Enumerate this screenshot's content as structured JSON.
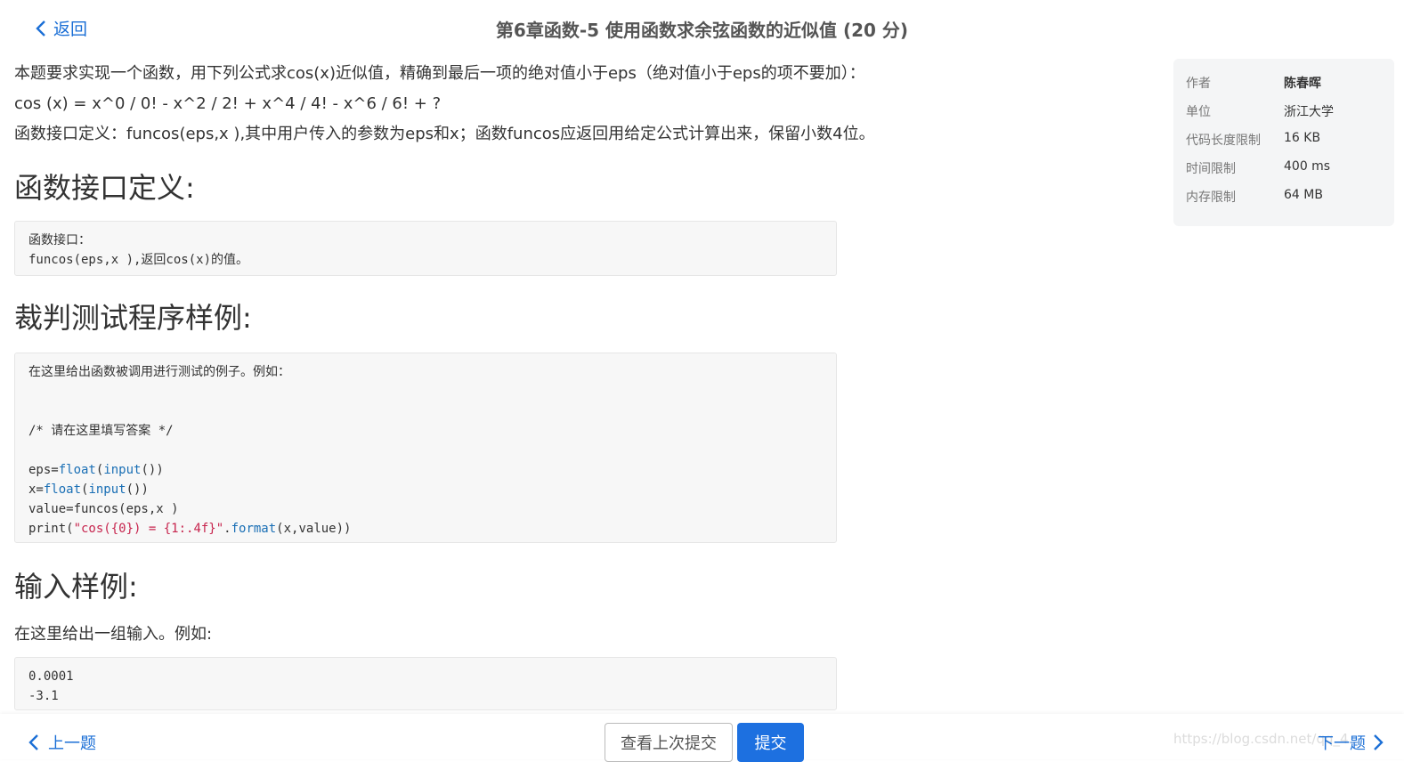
{
  "header": {
    "back_label": "返回",
    "title": "第6章函数-5 使用函数求余弦函数的近似值 (20 分)"
  },
  "description": {
    "line1": "本题要求实现一个函数，用下列公式求cos(x)近似值，精确到最后一项的绝对值小于eps（绝对值小于eps的项不要加）：",
    "line2": "cos (x) = x^0 / 0! - x^2 / 2! + x^4 / 4! - x^6 / 6! + ?",
    "line3": "函数接口定义：funcos(eps,x ),其中用户传入的参数为eps和x；函数funcos应返回用给定公式计算出来，保留小数4位。"
  },
  "sections": {
    "interface_heading": "函数接口定义:",
    "interface_code": [
      "函数接口：",
      "funcos(eps,x ),返回cos(x)的值。"
    ],
    "judge_heading": "裁判测试程序样例:",
    "judge_intro": "在这里给出函数被调用进行测试的例子。例如：",
    "judge_comment": "/* 请在这里填写答案 */",
    "judge_line1_a": "eps=",
    "judge_line1_b": "float",
    "judge_line1_c": "(",
    "judge_line1_d": "input",
    "judge_line1_e": "())",
    "judge_line2_a": "x=",
    "judge_line2_b": "float",
    "judge_line2_c": "(",
    "judge_line2_d": "input",
    "judge_line2_e": "())",
    "judge_line3": "value=funcos(eps,x )",
    "judge_line4_a": "print(",
    "judge_line4_b": "\"cos({0}) = {1:.4f}\"",
    "judge_line4_c": ".",
    "judge_line4_d": "format",
    "judge_line4_e": "(x,value))",
    "input_heading": "输入样例:",
    "input_intro": "在这里给出一组输入。例如:",
    "input_code": [
      "0.0001",
      "-3.1"
    ]
  },
  "sidebar": {
    "rows": [
      {
        "key": "作者",
        "value": "陈春晖"
      },
      {
        "key": "单位",
        "value": "浙江大学"
      },
      {
        "key": "代码长度限制",
        "value": "16 KB"
      },
      {
        "key": "时间限制",
        "value": "400 ms"
      },
      {
        "key": "内存限制",
        "value": "64 MB"
      }
    ]
  },
  "footer": {
    "prev_label": "上一题",
    "history_label": "查看上次提交",
    "submit_label": "提交",
    "next_label": "下一题",
    "watermark": "https://blog.csdn.net/qq_4..."
  },
  "colors": {
    "link": "#1b6fd6",
    "submit_bg": "#1d70e0",
    "keyword": "#1a6fb5",
    "string": "#c7254e"
  }
}
